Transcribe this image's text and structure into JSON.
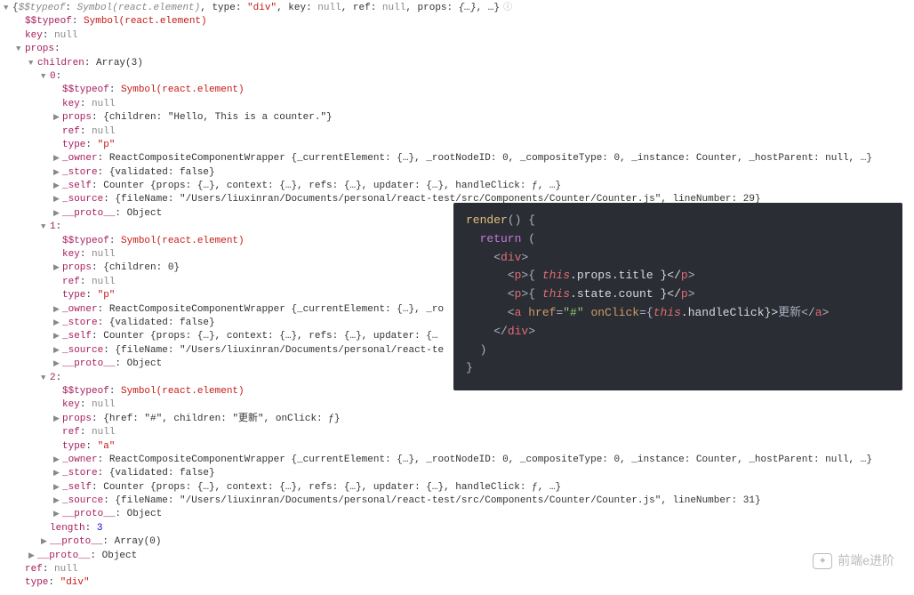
{
  "root": {
    "summary_pre": "$$typeof",
    "summary_sym": "Symbol(react.element)",
    "summary_rest": ", type: ",
    "summary_type": "\"div\"",
    "summary_rest2": ", key: ",
    "summary_null": "null",
    "summary_rest3": ", ref: ",
    "summary_rest4": ", props: ",
    "summary_obj": "{…}",
    "summary_tail": ", …}",
    "typeof_key": "$$typeof",
    "typeof_val": "Symbol(react.element)",
    "key_key": "key",
    "null": "null",
    "props_key": "props",
    "children_key": "children",
    "children_val": "Array(3)",
    "ref_key": "ref",
    "type_key": "type",
    "type_val": "\"div\"",
    "proto_key": "__proto__",
    "proto_val": "Object",
    "proto_arr": "Array(0)"
  },
  "child0": {
    "idx": "0",
    "typeof_key": "$$typeof",
    "typeof_val": "Symbol(react.element)",
    "key_key": "key",
    "null": "null",
    "props_key": "props",
    "props_val": "{children: \"Hello, This is a counter.\"}",
    "ref_key": "ref",
    "type_key": "type",
    "type_val": "\"p\"",
    "owner_key": "_owner",
    "owner_val": "ReactCompositeComponentWrapper {_currentElement: {…}, _rootNodeID: 0, _compositeType: 0, _instance: Counter, _hostParent: null, …}",
    "store_key": "_store",
    "store_val": "{validated: false}",
    "self_key": "_self",
    "self_val": "Counter {props: {…}, context: {…}, refs: {…}, updater: {…}, handleClick: ƒ, …}",
    "source_key": "_source",
    "source_val": "{fileName: \"/Users/liuxinran/Documents/personal/react-test/src/Components/Counter/Counter.js\", lineNumber: 29}",
    "proto_key": "__proto__",
    "proto_val": "Object"
  },
  "child1": {
    "idx": "1",
    "typeof_key": "$$typeof",
    "typeof_val": "Symbol(react.element)",
    "key_key": "key",
    "null": "null",
    "props_key": "props",
    "props_val": "{children: 0}",
    "ref_key": "ref",
    "type_key": "type",
    "type_val": "\"p\"",
    "owner_key": "_owner",
    "owner_val": "ReactCompositeComponentWrapper {_currentElement: {…}, _ro",
    "store_key": "_store",
    "store_val": "{validated: false}",
    "self_key": "_self",
    "self_val": "Counter {props: {…}, context: {…}, refs: {…}, updater: {…",
    "source_key": "_source",
    "source_val": "{fileName: \"/Users/liuxinran/Documents/personal/react-te",
    "proto_key": "__proto__",
    "proto_val": "Object"
  },
  "child2": {
    "idx": "2",
    "typeof_key": "$$typeof",
    "typeof_val": "Symbol(react.element)",
    "key_key": "key",
    "null": "null",
    "props_key": "props",
    "props_val": "{href: \"#\", children: \"更新\", onClick: ƒ}",
    "ref_key": "ref",
    "type_key": "type",
    "type_val": "\"a\"",
    "owner_key": "_owner",
    "owner_val": "ReactCompositeComponentWrapper {_currentElement: {…}, _rootNodeID: 0, _compositeType: 0, _instance: Counter, _hostParent: null, …}",
    "store_key": "_store",
    "store_val": "{validated: false}",
    "self_key": "_self",
    "self_val": "Counter {props: {…}, context: {…}, refs: {…}, updater: {…}, handleClick: ƒ, …}",
    "source_key": "_source",
    "source_val": "{fileName: \"/Users/liuxinran/Documents/personal/react-test/src/Components/Counter/Counter.js\", lineNumber: 31}",
    "proto_key": "__proto__",
    "proto_val": "Object"
  },
  "length_key": "length",
  "length_val": "3",
  "code": {
    "l1a": "render",
    "l1b": "() {",
    "l2a": "  return",
    "l2b": " (",
    "l3a": "    <",
    "l3b": "div",
    "l3c": ">",
    "l4a": "      <",
    "l4b": "p",
    "l4c": ">{ ",
    "l4d": "this",
    "l4e": ".props.title }</",
    "l4f": "p",
    "l4g": ">",
    "l5a": "      <",
    "l5b": "p",
    "l5c": ">{ ",
    "l5d": "this",
    "l5e": ".state.count }</",
    "l5f": "p",
    "l5g": ">",
    "l6a": "      <",
    "l6b": "a",
    "l6c": " href",
    "l6d": "=",
    "l6e": "\"#\"",
    "l6f": " onClick",
    "l6g": "={",
    "l6h": "this",
    "l6i": ".handleClick}>",
    "l6j": "更新",
    "l6k": "</",
    "l6l": "a",
    "l6m": ">",
    "l7a": "    </",
    "l7b": "div",
    "l7c": ">",
    "l8": "  )",
    "l9": "}"
  },
  "watermark": "前端e进阶"
}
